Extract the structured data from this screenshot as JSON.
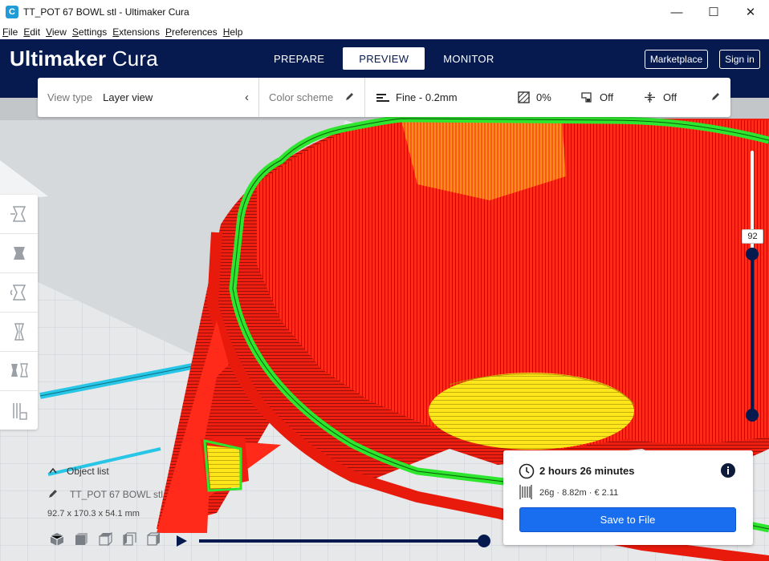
{
  "window": {
    "title": "TT_POT 67 BOWL stl - Ultimaker Cura",
    "app_icon_letter": "C",
    "minimize_glyph": "—",
    "maximize_glyph": "☐",
    "close_glyph": "✕"
  },
  "menu": [
    "File",
    "Edit",
    "View",
    "Settings",
    "Extensions",
    "Preferences",
    "Help"
  ],
  "header": {
    "logo_bold": "Ultimaker",
    "logo_light": "Cura",
    "stages": [
      {
        "label": "PREPARE",
        "active": false
      },
      {
        "label": "PREVIEW",
        "active": true
      },
      {
        "label": "MONITOR",
        "active": false
      }
    ],
    "marketplace_label": "Marketplace",
    "signin_label": "Sign in"
  },
  "toolbar": {
    "view_type_label": "View type",
    "view_type_value": "Layer view",
    "color_scheme_label": "Color scheme",
    "profile_value": "Fine - 0.2mm",
    "infill_value": "0%",
    "support_value": "Off",
    "adhesion_value": "Off",
    "icons": {
      "collapse": "chevron-left-icon",
      "edit": "pencil-icon",
      "profile": "profile-bars-icon",
      "infill": "infill-icon",
      "support": "support-icon",
      "adhesion": "adhesion-icon"
    }
  },
  "tools": [
    "move-icon",
    "scale-icon",
    "rotate-icon",
    "mirror-icon",
    "per-model-settings-icon",
    "support-blocker-icon"
  ],
  "object_list": {
    "header": "Object list",
    "object_name": "TT_POT 67 BOWL stl",
    "dimensions": "92.7 x 170.3 x 54.1 mm"
  },
  "layer_slider": {
    "current_layer": "92",
    "upper_handle_fraction": 0.61,
    "lower_handle_fraction": 0.0
  },
  "view_buttons": [
    "3d-view-icon",
    "front-view-icon",
    "top-view-icon",
    "left-view-icon",
    "right-view-icon"
  ],
  "simulation": {
    "play_icon": "play-icon",
    "progress_fraction": 1.0
  },
  "print_info": {
    "time": "2 hours 26 minutes",
    "material": "26g · 8.82m · € 2.11",
    "save_label": "Save to File"
  },
  "colors": {
    "header_bg": "#061a4f",
    "accent_blue": "#196ef0",
    "wall_red": "#ff2a1a",
    "outer_wall_green": "#2ee62e",
    "skin_yellow": "#ffe61a",
    "support_cyan": "#27c6e6"
  }
}
